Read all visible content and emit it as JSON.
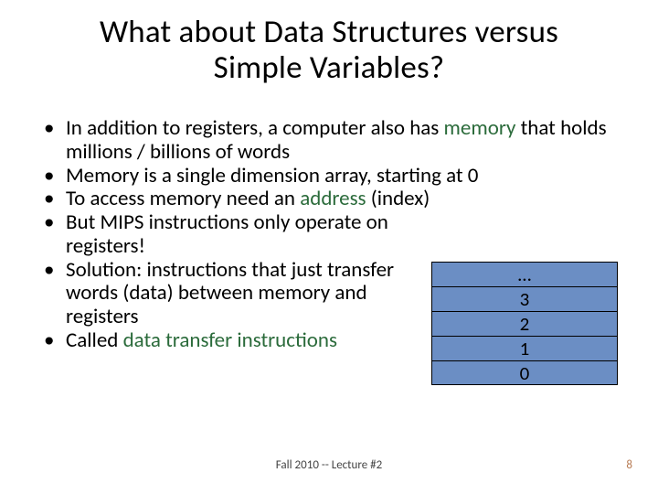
{
  "title": {
    "line1": "What about Data Structures versus",
    "line2": "Simple Variables?"
  },
  "bullets": [
    {
      "pre": "In addition to registers, a computer also has ",
      "accent": "memory",
      "post": " that holds millions / billions of words",
      "narrow": false
    },
    {
      "pre": "Memory is a single dimension array, starting at 0",
      "accent": "",
      "post": "",
      "narrow": false
    },
    {
      "pre": "To access memory need an ",
      "accent": "address",
      "post": " (index)",
      "narrow": false
    },
    {
      "pre": "But MIPS instructions only operate on registers!",
      "accent": "",
      "post": "",
      "narrow": true
    },
    {
      "pre": "Solution: instructions that just transfer words (data) between memory and registers",
      "accent": "",
      "post": "",
      "narrow": true
    },
    {
      "pre": "Called ",
      "accent": "data transfer instructions",
      "post": "",
      "narrow": true
    }
  ],
  "stack": [
    "…",
    "3",
    "2",
    "1",
    "0"
  ],
  "footer": {
    "center": "Fall 2010 -- Lecture #2",
    "page": "8"
  },
  "colors": {
    "accent": "#2b6b3b",
    "cell_bg": "#6b8ec4"
  }
}
